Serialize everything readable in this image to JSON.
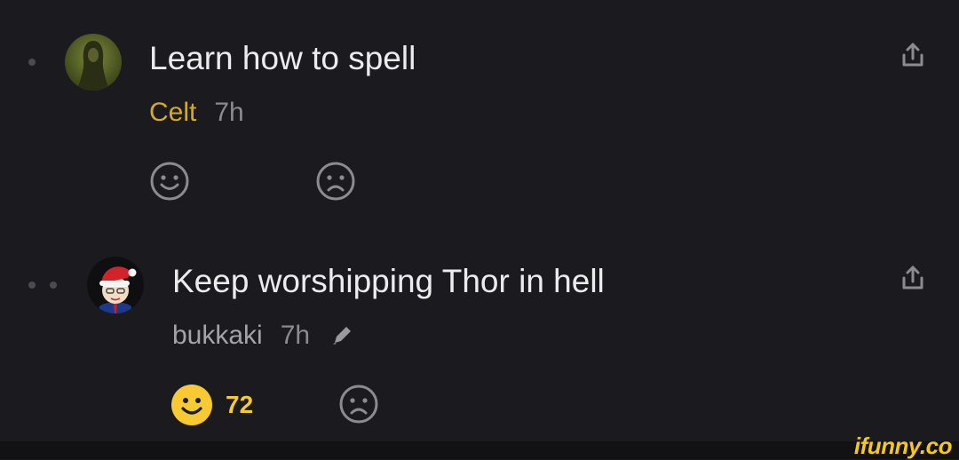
{
  "comments": [
    {
      "text": "Learn how to spell",
      "username": "Celt",
      "username_color": "#d7a928",
      "time": "7h",
      "avatar": "hooded-figure-avatar",
      "edited": false,
      "smile_count": null
    },
    {
      "text": "Keep worshipping Thor in hell",
      "username": "bukkaki",
      "username_color": "#a3a3a8",
      "time": "7h",
      "avatar": "santa-hat-cartoon-avatar",
      "edited": true,
      "smile_count": "72"
    }
  ],
  "icons": {
    "share": "share-icon",
    "smile": "smile-icon",
    "frown": "frown-icon",
    "edit": "pencil-icon"
  },
  "colors": {
    "background": "#1b1b1f",
    "active_smile": "#f7c932",
    "inactive_icon": "#8b8b90"
  },
  "watermark": "ifunny.co"
}
